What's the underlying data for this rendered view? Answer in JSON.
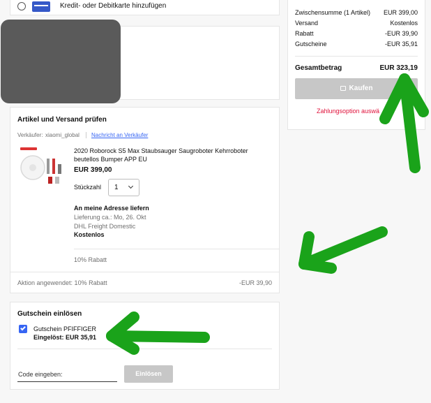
{
  "payment": {
    "add_card_label": "Kredit- oder Debitkarte hinzufügen"
  },
  "summary": {
    "rows": [
      {
        "label": "Zwischensumme (1 Artikel)",
        "value": "EUR 399,00"
      },
      {
        "label": "Versand",
        "value": "Kostenlos"
      },
      {
        "label": "Rabatt",
        "value": "-EUR 39,90"
      },
      {
        "label": "Gutscheine",
        "value": "-EUR 35,91"
      }
    ],
    "total_label": "Gesamtbetrag",
    "total_value": "EUR 323,19",
    "buy_button": "Kaufen",
    "payment_notice": "Zahlungsoption auswä"
  },
  "review": {
    "title": "Artikel und Versand prüfen",
    "seller_label": "Verkäufer:",
    "seller_name": "xiaomi_global",
    "contact_link": "Nachricht an Verkäufer",
    "item_title": "2020 Roborock S5 Max Staubsauger Saugroboter Kehrroboter beutellos Bumper APP EU",
    "item_price": "EUR 399,00",
    "qty_label": "Stückzahl",
    "qty_value": "1",
    "delivery_heading": "An meine Adresse liefern",
    "delivery_date": "Lieferung ca.: Mo, 26. Okt",
    "delivery_carrier": "DHL Freight Domestic",
    "delivery_cost": "Kostenlos",
    "discount_note": "10% Rabatt",
    "action_label": "Aktion angewendet: 10% Rabatt",
    "action_value": "-EUR 39,90"
  },
  "coupon": {
    "title": "Gutschein einlösen",
    "code_label": "Gutschein PFIFFIGER",
    "redeemed": "Eingelöst: EUR 35,91",
    "input_label": "Code eingeben:",
    "redeem_button": "Einlösen"
  },
  "colors": {
    "accent_link": "#3665f3",
    "notice_red": "#e0103a",
    "annotation_green": "#1aa31a",
    "checkbox_blue": "#3665f3"
  }
}
